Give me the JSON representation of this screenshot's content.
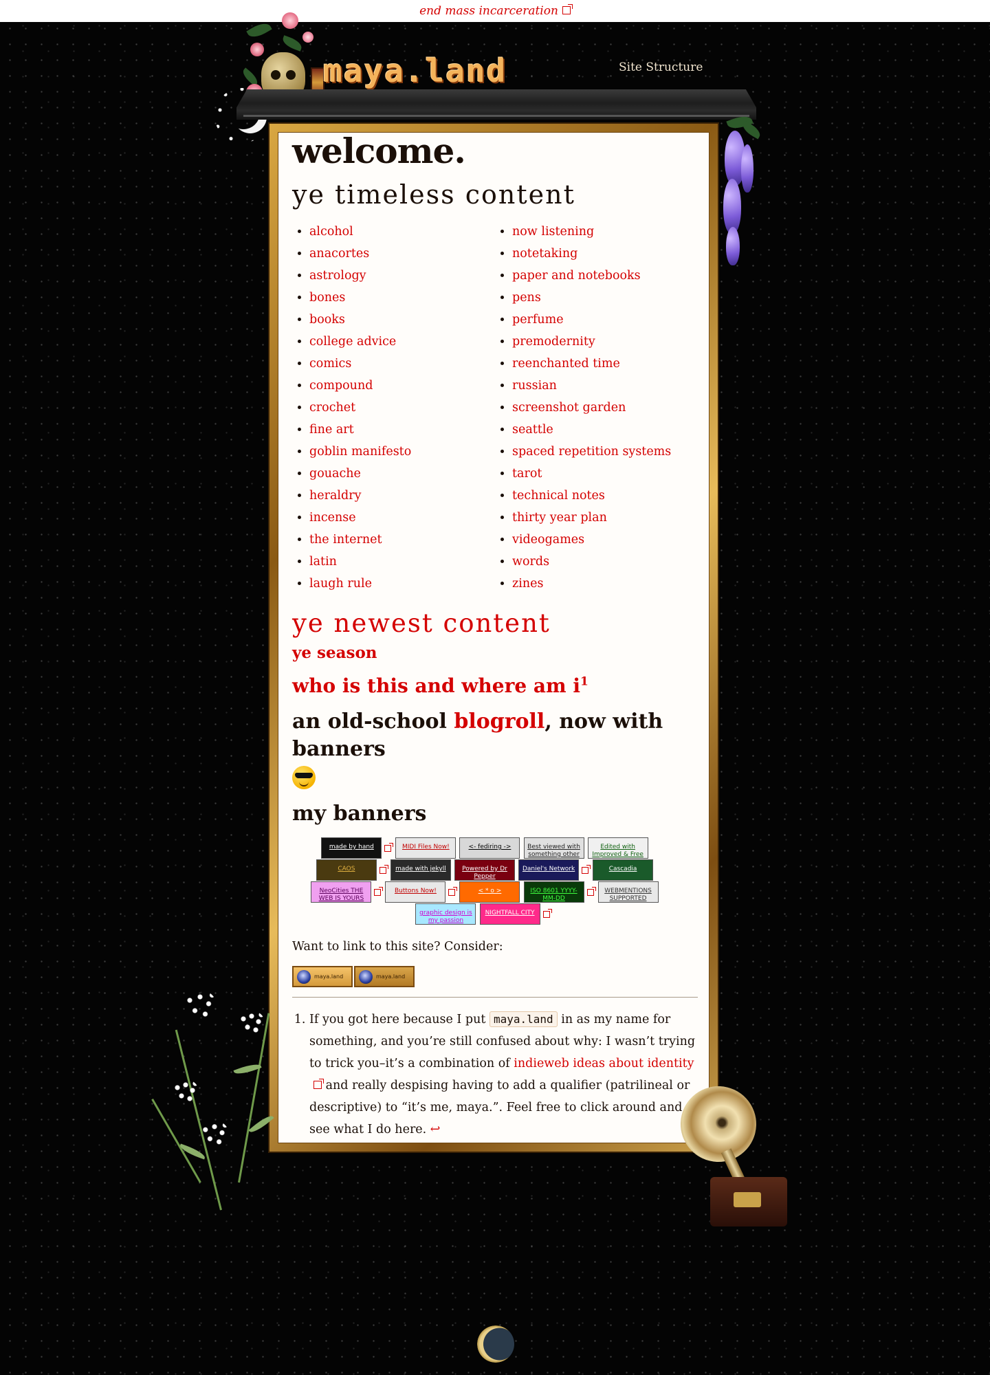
{
  "topbar": {
    "link_text": "end mass incarceration"
  },
  "header": {
    "logo": "maya.land",
    "nav_link": "Site Structure"
  },
  "main": {
    "title": "welcome.",
    "timeless_heading": "ye timeless content",
    "timeless_left": [
      "alcohol",
      "anacortes",
      "astrology",
      "bones",
      "books",
      "college advice",
      "comics",
      "compound",
      "crochet",
      "fine art",
      "goblin manifesto",
      "gouache",
      "heraldry",
      "incense",
      "the internet",
      "latin",
      "laugh rule"
    ],
    "timeless_right": [
      "now listening",
      "notetaking",
      "paper and notebooks",
      "pens",
      "perfume",
      "premodernity",
      "reenchanted time",
      "russian",
      "screenshot garden",
      "seattle",
      "spaced repetition systems",
      "tarot",
      "technical notes",
      "thirty year plan",
      "videogames",
      "words",
      "zines"
    ],
    "newest_heading": "ye newest content",
    "season_link": "ye season",
    "who_link": "who is this and where am i",
    "who_sup": "1",
    "blogroll_before": "an old-school ",
    "blogroll_link": "blogroll",
    "blogroll_after": ", now with banners",
    "banners_heading": "my banners",
    "banners": [
      {
        "text": "made by hand",
        "bg": "#111111",
        "fg": "#ffffff"
      },
      {
        "text": "MIDI Files Now!",
        "bg": "#e8e8e8",
        "fg": "#c00000"
      },
      {
        "text": "<- fediring ->",
        "bg": "#d8d8d8",
        "fg": "#000000"
      },
      {
        "text": "Best viewed with something other than Safari",
        "bg": "#e0e0e0",
        "fg": "#222222"
      },
      {
        "text": "Edited with Improved & Free",
        "bg": "#f0f0f0",
        "fg": "#106010"
      },
      {
        "text": "CAOS",
        "bg": "#4a3a10",
        "fg": "#e0b040"
      },
      {
        "text": "made with jekyll",
        "bg": "#2a2a2a",
        "fg": "#ffffff"
      },
      {
        "text": "Powered by Dr Pepper",
        "bg": "#7a0010",
        "fg": "#ffffff"
      },
      {
        "text": "Daniel's Network",
        "bg": "#1a1a5a",
        "fg": "#ffffff"
      },
      {
        "text": "Cascadia",
        "bg": "#1a5a2a",
        "fg": "#ffffff"
      },
      {
        "text": "NeoCities THE WEB IS YOURS",
        "bg": "#f0a0f0",
        "fg": "#5a005a"
      },
      {
        "text": "Buttons Now!",
        "bg": "#e8e8e8",
        "fg": "#c00000"
      },
      {
        "text": "< * o >",
        "bg": "#ff6a00",
        "fg": "#ffffff"
      },
      {
        "text": "ISO 8601 YYYY-MM-DD",
        "bg": "#0a3a0a",
        "fg": "#40ff40"
      },
      {
        "text": "WEBMENTIONS SUPPORTED",
        "bg": "#e8e8e8",
        "fg": "#333333"
      },
      {
        "text": "graphic design is my passion",
        "bg": "#a8e8ff",
        "fg": "#d000d0"
      },
      {
        "text": "NIGHTFALL CITY",
        "bg": "#ff2a8a",
        "fg": "#ffffff"
      }
    ],
    "link_prompt": "Want to link to this site? Consider:",
    "my_banners": [
      "maya.land",
      "maya.land"
    ],
    "footnote_before": "If you got here because I put ",
    "footnote_code": "maya.land",
    "footnote_mid": " in as my name for something, and you’re still confused about why: I wasn’t trying to trick you–it’s a combination of ",
    "footnote_link": "indieweb ideas about identity",
    "footnote_after": " and really despising having to add a qualifier (patrilineal or descriptive) to “it’s me, maya.”. Feel free to click around and see what I do here. ",
    "footnote_backref": "↩"
  },
  "colors": {
    "link": "#d40000",
    "background": "#040404",
    "paper": "#fffdfa",
    "frame": "#d9a742",
    "logo": "#f4b35b"
  }
}
